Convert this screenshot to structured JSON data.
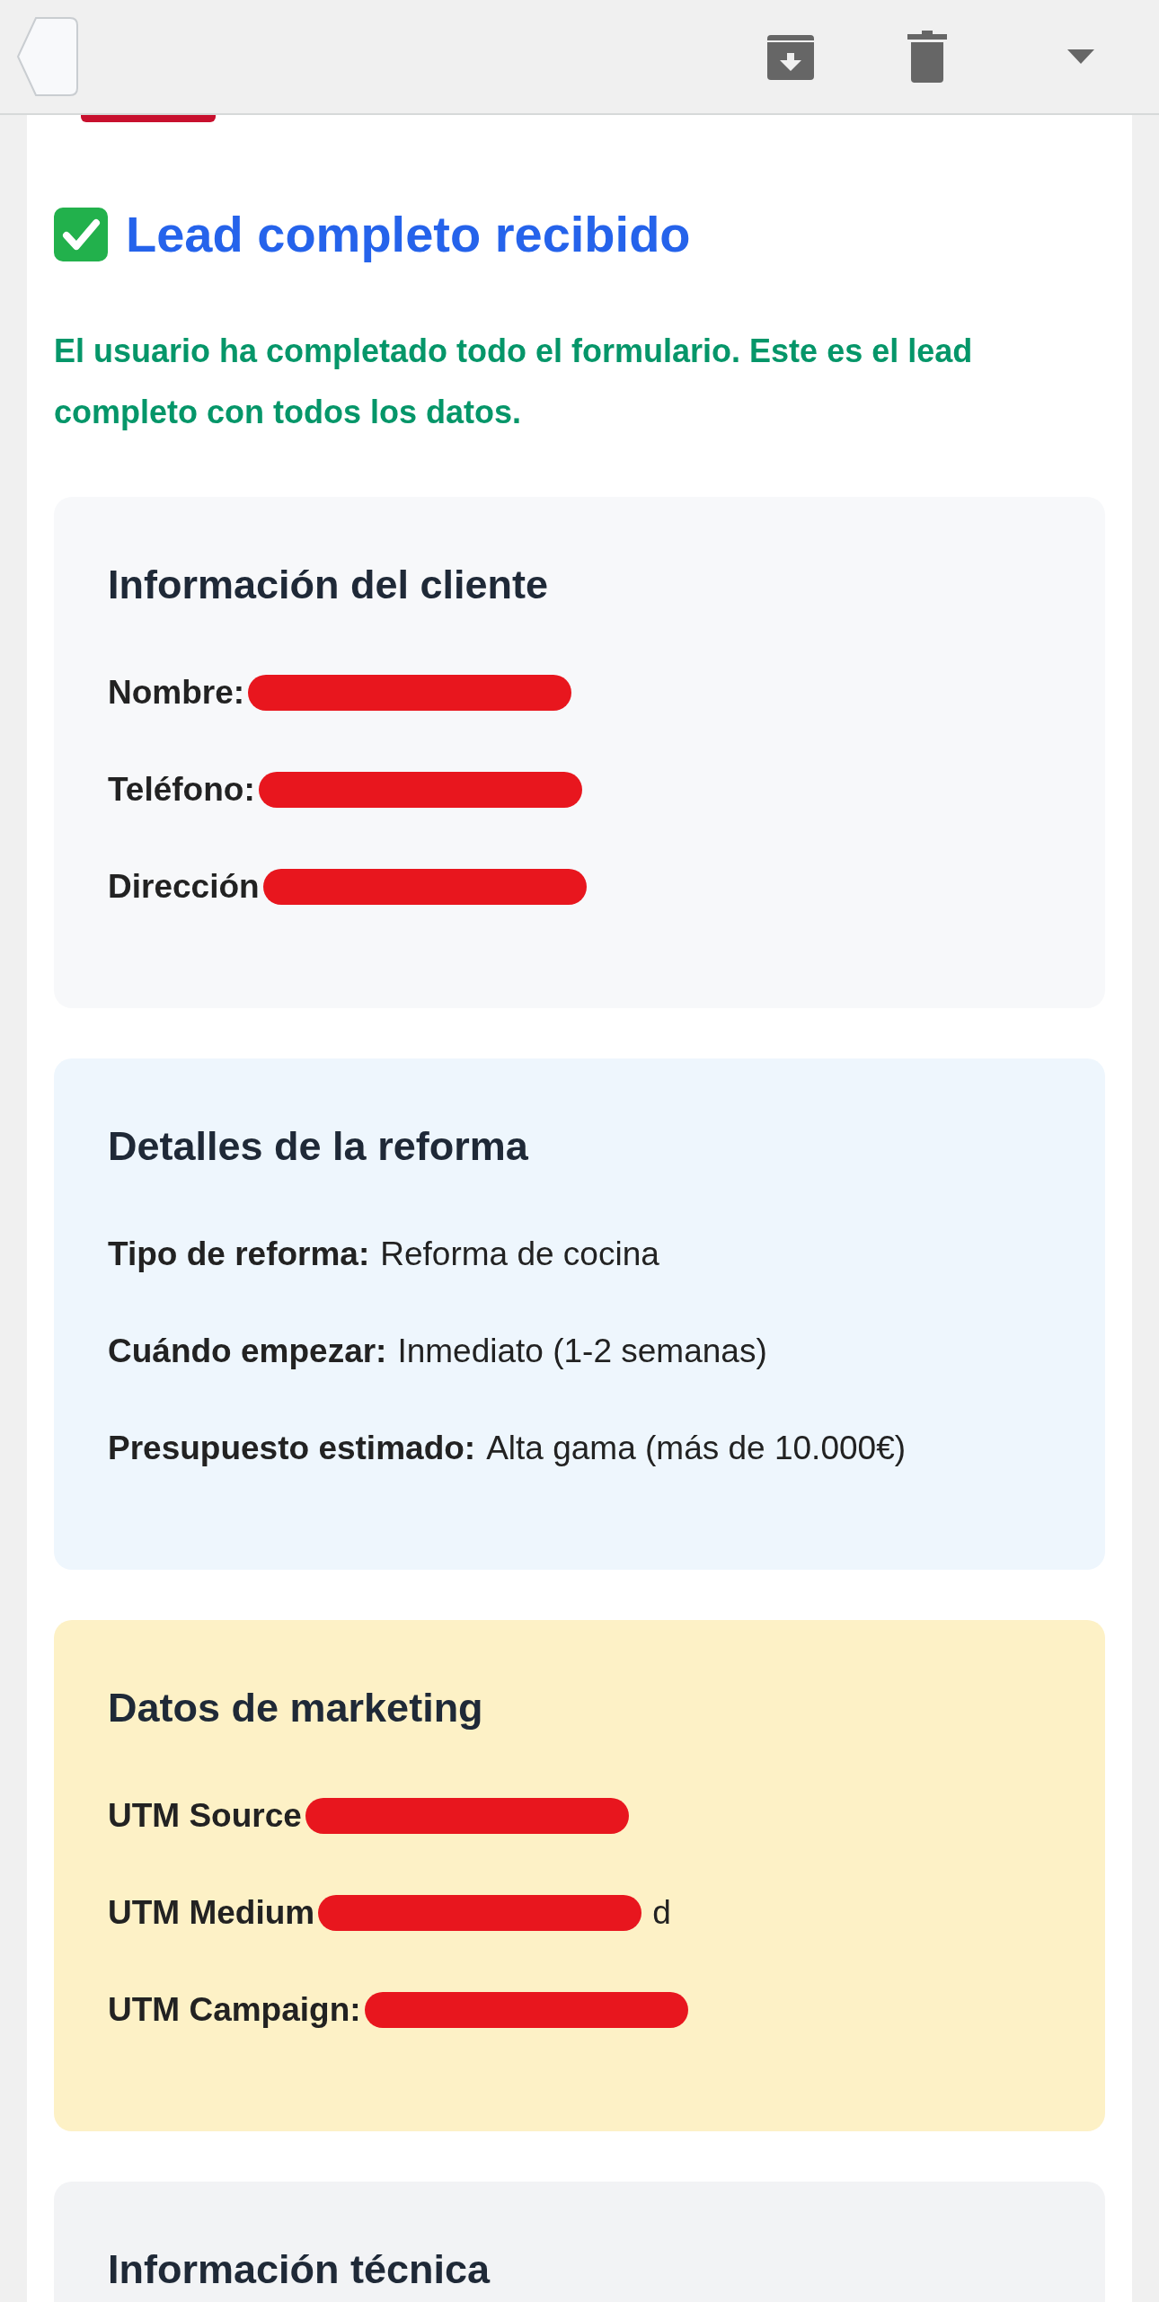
{
  "heading": {
    "title": "Lead completo recibido"
  },
  "notice": "El usuario ha completado todo el formulario. Este es el lead completo con todos los datos.",
  "sections": [
    {
      "kind": "client",
      "title": "Información del cliente",
      "fields": [
        {
          "label": "Nombre:",
          "redacted": true
        },
        {
          "label": "Teléfono:",
          "redacted": true
        },
        {
          "label": "Dirección",
          "redacted": true
        }
      ]
    },
    {
      "kind": "details",
      "title": "Detalles de la reforma",
      "fields": [
        {
          "label": "Tipo de reforma:",
          "value": "Reforma de cocina",
          "redacted": false
        },
        {
          "label": "Cuándo empezar:",
          "value": "Inmediato (1-2 semanas)",
          "redacted": false
        },
        {
          "label": "Presupuesto estimado:",
          "value": "Alta gama (más de 10.000€)",
          "redacted": false
        }
      ]
    },
    {
      "kind": "marketing",
      "title": "Datos de marketing",
      "fields": [
        {
          "label": "UTM Source",
          "redacted": true
        },
        {
          "label": "UTM Medium",
          "value": "d",
          "redacted": true
        },
        {
          "label": "UTM Campaign:",
          "redacted": true
        }
      ]
    },
    {
      "kind": "technical",
      "title": "Información técnica"
    }
  ]
}
